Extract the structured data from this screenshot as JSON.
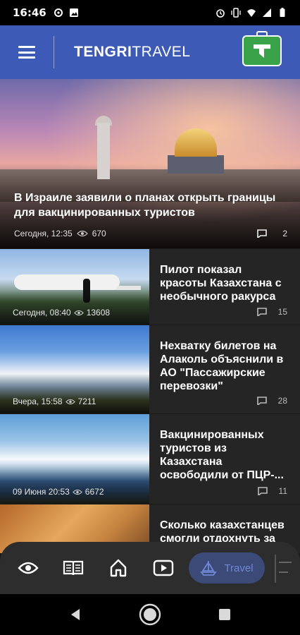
{
  "status_bar": {
    "time": "16:46"
  },
  "header": {
    "brand_bold": "TENGRI",
    "brand_light": "TRAVEL"
  },
  "hero": {
    "title": "В Израиле заявили о планах открыть границы для вакцинированных туристов",
    "date": "Сегодня, 12:35",
    "views": "670",
    "comments": "2"
  },
  "news": [
    {
      "title": "Пилот показал красоты Казахстана с необычного ракурса",
      "date": "Сегодня, 08:40",
      "views": "13608",
      "comments": "15"
    },
    {
      "title": "Нехватку билетов на Алаколь объяснили в АО \"Пассажирские перевозки\"",
      "date": "Вчера, 15:58",
      "views": "7211",
      "comments": "28"
    },
    {
      "title": "Вакцинированных туристов из Казахстана освободили от ПЦР-...",
      "date": "09 Июня 20:53",
      "views": "6672",
      "comments": "11"
    },
    {
      "title": "Сколько казахстанцев смогли отдохнуть за",
      "date": "",
      "views": "",
      "comments": ""
    }
  ],
  "bottom_nav": {
    "travel_label": "Travel",
    "items": [
      "eye-icon",
      "book-icon",
      "home-icon",
      "play-icon",
      "sailboat-icon"
    ]
  },
  "colors": {
    "header_bg": "#3d5bb6",
    "accent_green": "#3aa34a",
    "nav_active_bg": "#3c4a78",
    "nav_active_text": "#6f87d8"
  }
}
